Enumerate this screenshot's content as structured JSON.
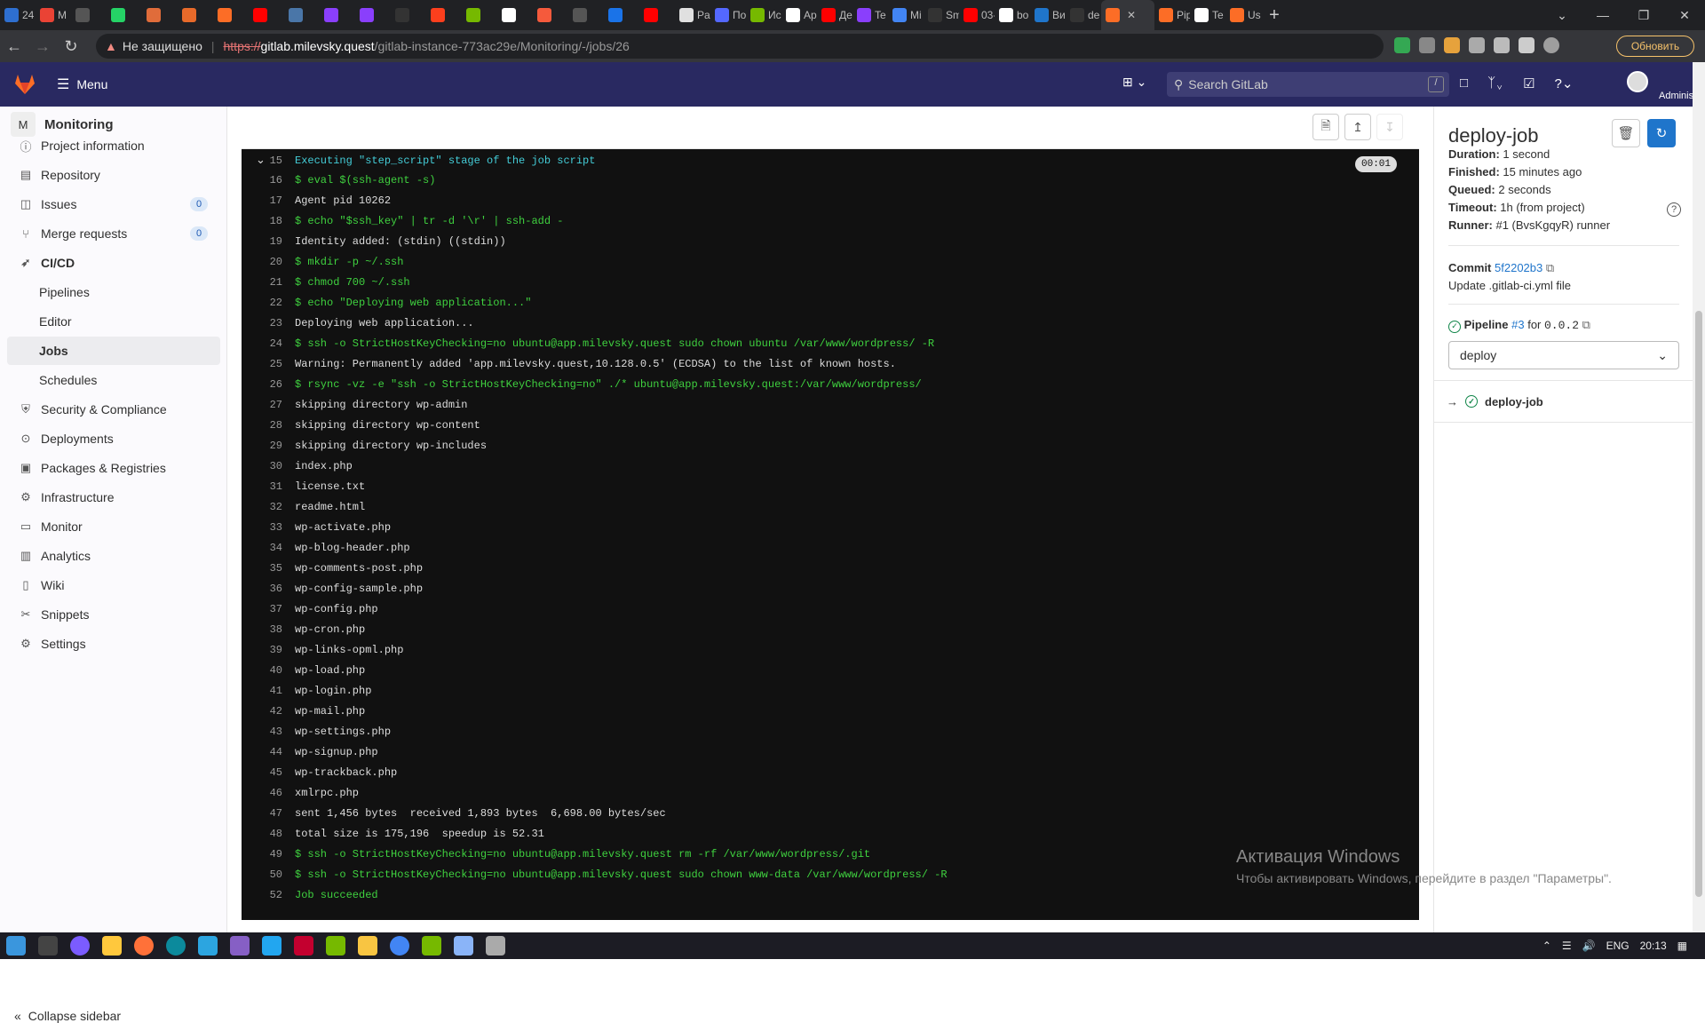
{
  "browser": {
    "tabs": [
      {
        "label": "24",
        "color": "#2e6fd0"
      },
      {
        "label": "M",
        "color": "#ea4335"
      },
      {
        "label": "",
        "color": "#555"
      },
      {
        "label": "",
        "color": "#25d366"
      },
      {
        "label": "",
        "color": "#e06c3a"
      },
      {
        "label": "",
        "color": "#e86a2a"
      },
      {
        "label": "",
        "color": "#fc6d26"
      },
      {
        "label": "",
        "color": "#ff0000"
      },
      {
        "label": "",
        "color": "#4a76a8"
      },
      {
        "label": "",
        "color": "#8a3ffc"
      },
      {
        "label": "",
        "color": "#8a3ffc"
      },
      {
        "label": "",
        "color": "#333"
      },
      {
        "label": "",
        "color": "#fc3f1d"
      },
      {
        "label": "",
        "color": "#76b900"
      },
      {
        "label": "",
        "color": "#ffffff"
      },
      {
        "label": "",
        "color": "#f55a3c"
      },
      {
        "label": "",
        "color": "#555"
      },
      {
        "label": "",
        "color": "#1a73e8"
      },
      {
        "label": "",
        "color": "#ff0000"
      },
      {
        "label": "Pa",
        "color": "#e0e0e0"
      },
      {
        "label": "По",
        "color": "#5468ff"
      },
      {
        "label": "Ис",
        "color": "#76b900"
      },
      {
        "label": "Ap",
        "color": "#ffffff"
      },
      {
        "label": "Де",
        "color": "#ff0000"
      },
      {
        "label": "Te",
        "color": "#8a3ffc"
      },
      {
        "label": "Mi",
        "color": "#4285f4"
      },
      {
        "label": "Sm",
        "color": "#333"
      },
      {
        "label": "03-",
        "color": "#ff0000"
      },
      {
        "label": "bo",
        "color": "#ffffff"
      },
      {
        "label": "Ви",
        "color": "#1f75cb"
      },
      {
        "label": "de",
        "color": "#333"
      },
      {
        "label": "",
        "color": "#fc6d26",
        "active": true
      },
      {
        "label": "Pip",
        "color": "#fc6d26"
      },
      {
        "label": "Te",
        "color": "#ffffff"
      },
      {
        "label": "Usi",
        "color": "#fc6d26"
      }
    ],
    "new_tab": "+",
    "window_controls": [
      "⌄",
      "—",
      "❐",
      "✕"
    ],
    "insecure_label": "Не защищено",
    "url_scheme": "https://",
    "url_host": "gitlab.milevsky.quest",
    "url_path": "/gitlab-instance-773ac29e/Monitoring/-/jobs/26",
    "update_label": "Обновить"
  },
  "gitlab_header": {
    "menu_label": "Menu",
    "search_placeholder": "Search GitLab",
    "search_shortcut": "/",
    "user_label": "Administrator"
  },
  "sidebar": {
    "project_initial": "M",
    "project_name": "Monitoring",
    "items": [
      {
        "label": "Project information",
        "icon": "info-icon"
      },
      {
        "label": "Repository",
        "icon": "book-icon"
      },
      {
        "label": "Issues",
        "icon": "issues-icon",
        "count": "0"
      },
      {
        "label": "Merge requests",
        "icon": "merge-request-icon",
        "count": "0"
      },
      {
        "label": "CI/CD",
        "icon": "rocket-icon"
      },
      {
        "label": "Pipelines",
        "sub": true
      },
      {
        "label": "Editor",
        "sub": true
      },
      {
        "label": "Jobs",
        "sub": true,
        "active": true
      },
      {
        "label": "Schedules",
        "sub": true
      },
      {
        "label": "Security & Compliance",
        "icon": "shield-icon"
      },
      {
        "label": "Deployments",
        "icon": "deployments-icon"
      },
      {
        "label": "Packages & Registries",
        "icon": "package-icon"
      },
      {
        "label": "Infrastructure",
        "icon": "cloud-gear-icon"
      },
      {
        "label": "Monitor",
        "icon": "monitor-icon"
      },
      {
        "label": "Analytics",
        "icon": "chart-icon"
      },
      {
        "label": "Wiki",
        "icon": "wiki-icon"
      },
      {
        "label": "Snippets",
        "icon": "snippet-icon"
      },
      {
        "label": "Settings",
        "icon": "settings-icon"
      }
    ],
    "collapse_label": "Collapse sidebar"
  },
  "log": {
    "section_duration": "00:01",
    "lines": [
      {
        "n": "15",
        "text": "Executing \"step_script\" stage of the job script",
        "style": "cyan"
      },
      {
        "n": "16",
        "text": "$ eval $(ssh-agent -s)",
        "style": "green"
      },
      {
        "n": "17",
        "text": "Agent pid 10262",
        "style": ""
      },
      {
        "n": "18",
        "text": "$ echo \"$ssh_key\" | tr -d '\\r' | ssh-add -",
        "style": "green"
      },
      {
        "n": "19",
        "text": "Identity added: (stdin) ((stdin))",
        "style": ""
      },
      {
        "n": "20",
        "text": "$ mkdir -p ~/.ssh",
        "style": "green"
      },
      {
        "n": "21",
        "text": "$ chmod 700 ~/.ssh",
        "style": "green"
      },
      {
        "n": "22",
        "text": "$ echo \"Deploying web application...\"",
        "style": "green"
      },
      {
        "n": "23",
        "text": "Deploying web application...",
        "style": ""
      },
      {
        "n": "24",
        "text": "$ ssh -o StrictHostKeyChecking=no ubuntu@app.milevsky.quest sudo chown ubuntu /var/www/wordpress/ -R",
        "style": "green"
      },
      {
        "n": "25",
        "text": "Warning: Permanently added 'app.milevsky.quest,10.128.0.5' (ECDSA) to the list of known hosts.",
        "style": ""
      },
      {
        "n": "26",
        "text": "$ rsync -vz -e \"ssh -o StrictHostKeyChecking=no\" ./* ubuntu@app.milevsky.quest:/var/www/wordpress/",
        "style": "green"
      },
      {
        "n": "27",
        "text": "skipping directory wp-admin",
        "style": ""
      },
      {
        "n": "28",
        "text": "skipping directory wp-content",
        "style": ""
      },
      {
        "n": "29",
        "text": "skipping directory wp-includes",
        "style": ""
      },
      {
        "n": "30",
        "text": "index.php",
        "style": ""
      },
      {
        "n": "31",
        "text": "license.txt",
        "style": ""
      },
      {
        "n": "32",
        "text": "readme.html",
        "style": ""
      },
      {
        "n": "33",
        "text": "wp-activate.php",
        "style": ""
      },
      {
        "n": "34",
        "text": "wp-blog-header.php",
        "style": ""
      },
      {
        "n": "35",
        "text": "wp-comments-post.php",
        "style": ""
      },
      {
        "n": "36",
        "text": "wp-config-sample.php",
        "style": ""
      },
      {
        "n": "37",
        "text": "wp-config.php",
        "style": ""
      },
      {
        "n": "38",
        "text": "wp-cron.php",
        "style": ""
      },
      {
        "n": "39",
        "text": "wp-links-opml.php",
        "style": ""
      },
      {
        "n": "40",
        "text": "wp-load.php",
        "style": ""
      },
      {
        "n": "41",
        "text": "wp-login.php",
        "style": ""
      },
      {
        "n": "42",
        "text": "wp-mail.php",
        "style": ""
      },
      {
        "n": "43",
        "text": "wp-settings.php",
        "style": ""
      },
      {
        "n": "44",
        "text": "wp-signup.php",
        "style": ""
      },
      {
        "n": "45",
        "text": "wp-trackback.php",
        "style": ""
      },
      {
        "n": "46",
        "text": "xmlrpc.php",
        "style": ""
      },
      {
        "n": "47",
        "text": "sent 1,456 bytes  received 1,893 bytes  6,698.00 bytes/sec",
        "style": ""
      },
      {
        "n": "48",
        "text": "total size is 175,196  speedup is 52.31",
        "style": ""
      },
      {
        "n": "49",
        "text": "$ ssh -o StrictHostKeyChecking=no ubuntu@app.milevsky.quest rm -rf /var/www/wordpress/.git",
        "style": "green"
      },
      {
        "n": "50",
        "text": "$ ssh -o StrictHostKeyChecking=no ubuntu@app.milevsky.quest sudo chown www-data /var/www/wordpress/ -R",
        "style": "green"
      },
      {
        "n": "52",
        "text": "Job succeeded",
        "style": "green"
      }
    ]
  },
  "job_panel": {
    "title": "deploy-job",
    "duration_label": "Duration:",
    "duration_value": "1 second",
    "finished_label": "Finished:",
    "finished_value": "15 minutes ago",
    "queued_label": "Queued:",
    "queued_value": "2 seconds",
    "timeout_label": "Timeout:",
    "timeout_value": "1h (from project)",
    "runner_label": "Runner:",
    "runner_value": "#1 (BvsKgqyR) runner",
    "commit_label": "Commit",
    "commit_sha": "5f2202b3",
    "commit_message": "Update .gitlab-ci.yml file",
    "pipeline_label": "Pipeline",
    "pipeline_id": "#3",
    "pipeline_for": "for",
    "pipeline_ref": "0.0.2",
    "stage": "deploy",
    "job_name": "deploy-job"
  },
  "os": {
    "activation_title": "Активация Windows",
    "activation_text": "Чтобы активировать Windows, перейдите в раздел \"Параметры\".",
    "lang": "ENG",
    "time": "20:13"
  }
}
